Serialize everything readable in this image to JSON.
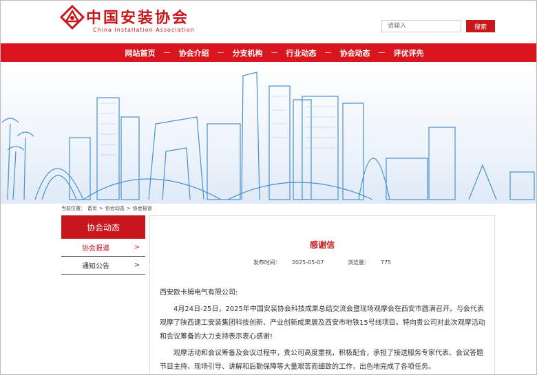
{
  "header": {
    "logo_cn": "中国安装协会",
    "logo_en": "China Installation Association",
    "search_placeholder": "请输入",
    "search_button": "搜索"
  },
  "nav": [
    "网站首页",
    "协会介绍",
    "分支机构",
    "行业动态",
    "协会动态",
    "评优评先"
  ],
  "nav_separator": "—",
  "breadcrumb": {
    "prefix": "当前位置：",
    "items": [
      "首页",
      "协会动态",
      "协会报道"
    ],
    "separator": ">"
  },
  "sidebar": {
    "title": "协会动态",
    "items": [
      {
        "label": "协会报道",
        "active": true
      },
      {
        "label": "通知公告",
        "active": false
      }
    ],
    "arrow": ">"
  },
  "article": {
    "title": "感谢信",
    "publish_label": "发布时间：",
    "publish_date": "2025-05-07",
    "views_label": "浏览量：",
    "views": "775",
    "salutation": "西安欧卡姆电气有限公司:",
    "paragraphs": [
      "4月24日-25日，2025年中国安装协会科技成果总结交流会暨现场观摩会在西安市圆满召开。与会代表观摩了陕西建工安装集团科技创新、产业创新成果展及西安市地铁15号线项目。特向贵公司对此次观摩活动和会议筹备的大力支持表示衷心感谢!",
      "观摩活动和会议筹备及会议过程中，贵公司高度重视，积极配合，承担了接送服务专家代表、会议答题节目主持、现场引导、讲解和后勤保障等大量艰苦而细致的工作，出色地完成了各项任务。"
    ]
  },
  "colors": {
    "brand_red": "#c8161d",
    "nav_red": "#d9161d",
    "skyline_blue": "#4a8fd0"
  }
}
